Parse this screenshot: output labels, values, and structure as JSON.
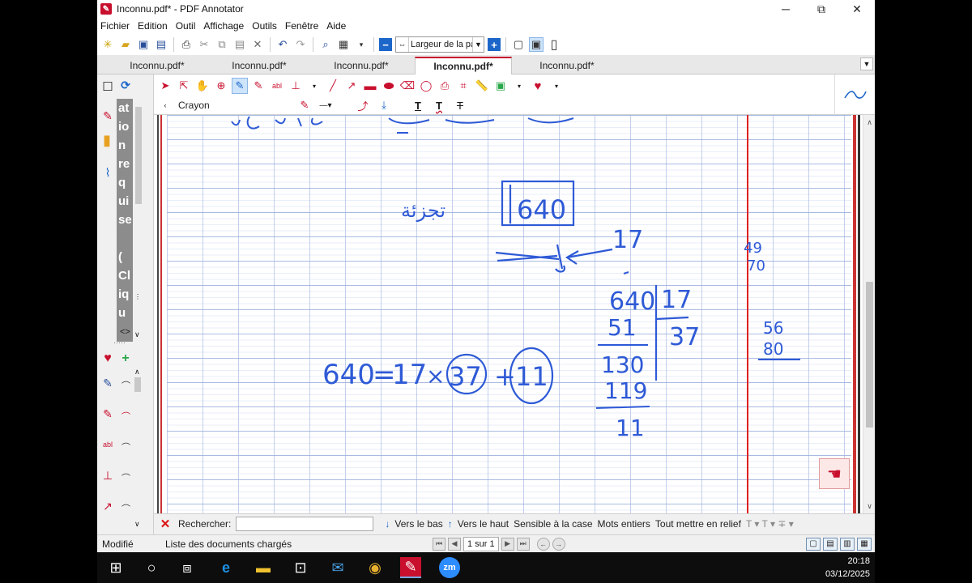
{
  "window": {
    "title": "Inconnu.pdf* - PDF Annotator",
    "minimize": "─",
    "maximize": "⧉",
    "close": "✕"
  },
  "menu": [
    "Fichier",
    "Edition",
    "Outil",
    "Affichage",
    "Outils",
    "Fenêtre",
    "Aide"
  ],
  "zoom": {
    "value": "Largeur de la pa"
  },
  "tabs": [
    {
      "label": "Inconnu.pdf*",
      "active": false
    },
    {
      "label": "Inconnu.pdf*",
      "active": false
    },
    {
      "label": "Inconnu.pdf*",
      "active": false
    },
    {
      "label": "Inconnu.pdf*",
      "active": true
    },
    {
      "label": "Inconnu.pdf*",
      "active": false
    }
  ],
  "side_panel": {
    "vertical_text": [
      "at",
      "io",
      "n",
      "re",
      "q",
      "ui",
      "se",
      "",
      "(",
      "Cl",
      "iq",
      "u"
    ]
  },
  "tool": {
    "name": "Crayon"
  },
  "handwriting": {
    "arabic_word": "تجزئة",
    "boxed_number": "640",
    "arrow_number": "17",
    "division": {
      "dividend": "640",
      "divisor": "17",
      "subtract1": "51",
      "partial": "130",
      "subtract2": "119",
      "quotient": "37",
      "remainder": "11"
    },
    "equation": {
      "lhs": "640",
      "divisor": "17",
      "quotient": "37",
      "remainder": "11"
    },
    "margin_numbers": {
      "top_a": "49",
      "top_b": "70",
      "bottom_a": "56",
      "bottom_b": "80"
    }
  },
  "search": {
    "label": "Rechercher:",
    "down": "Vers le bas",
    "up": "Vers le haut",
    "case": "Sensible à la case",
    "words": "Mots entiers",
    "highlight": "Tout mettre en relief"
  },
  "status": {
    "modified": "Modifié",
    "documents": "Liste des documents chargés",
    "page": "1 sur 1"
  },
  "clock": {
    "time": "20:18",
    "date": "03/12/2025"
  },
  "colors": {
    "accent": "#c8102e",
    "ink": "#2e5ad6",
    "margin": "#e02020"
  }
}
